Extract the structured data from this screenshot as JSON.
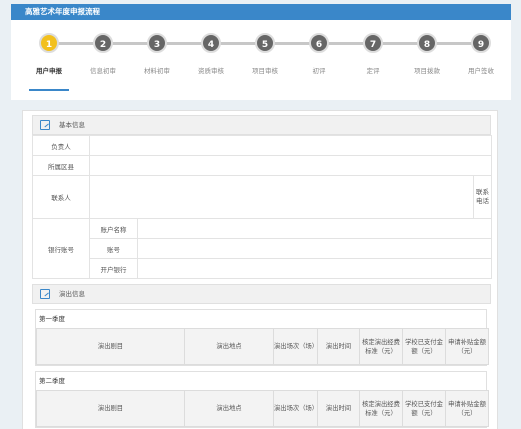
{
  "header": {
    "title": "高雅艺术年度申报流程"
  },
  "steps": [
    {
      "num": "1",
      "label": "用户申报",
      "active": true
    },
    {
      "num": "2",
      "label": "信息初审"
    },
    {
      "num": "3",
      "label": "材料初审"
    },
    {
      "num": "4",
      "label": "资质审核"
    },
    {
      "num": "5",
      "label": "项目审核"
    },
    {
      "num": "6",
      "label": "初评"
    },
    {
      "num": "7",
      "label": "定评"
    },
    {
      "num": "8",
      "label": "项目拨款"
    },
    {
      "num": "9",
      "label": "用户签收"
    }
  ],
  "basic_info": {
    "title": "基本信息",
    "owner_label": "负责人",
    "district_label": "所属区县",
    "contact_label": "联系人",
    "phone_label": "联系电话",
    "bank_label": "银行账号",
    "account_name_label": "账户名称",
    "account_no_label": "账号",
    "bank_open_label": "开户银行"
  },
  "performance_info": {
    "title": "演出信息",
    "quarters": [
      "第一季度",
      "第二季度"
    ],
    "columns": [
      "演出剧目",
      "演出地点",
      "演出场次（场）",
      "演出时间",
      "核定演出经费标准（元）",
      "学校已支付金额（元）",
      "申请补贴金额（元）"
    ]
  }
}
